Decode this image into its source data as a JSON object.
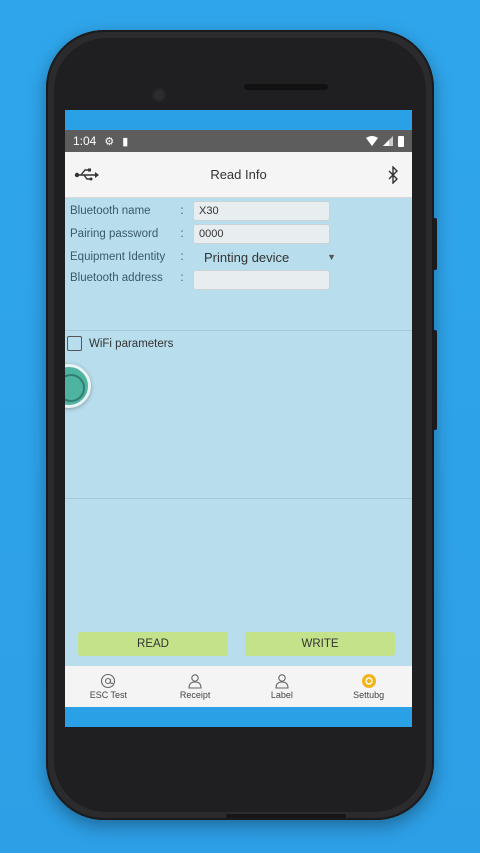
{
  "status": {
    "time": "1:04"
  },
  "appbar": {
    "title": "Read Info"
  },
  "form": {
    "bluetooth_name_label": "Bluetooth name",
    "bluetooth_name_value": "X30",
    "pairing_password_label": "Pairing password",
    "pairing_password_value": "0000",
    "equipment_identity_label": "Equipment Identity",
    "equipment_identity_value": "Printing device",
    "bluetooth_address_label": "Bluetooth address",
    "bluetooth_address_value": "",
    "colon": ":"
  },
  "wifi": {
    "label": "WiFi parameters",
    "checked": false
  },
  "buttons": {
    "read": "READ",
    "write": "WRITE"
  },
  "tabs": [
    {
      "label": "ESC Test",
      "icon": "at-icon"
    },
    {
      "label": "Receipt",
      "icon": "receipt-icon"
    },
    {
      "label": "Label",
      "icon": "label-icon"
    },
    {
      "label": "Settubg",
      "icon": "settings-icon",
      "active_color": "#f3b31b"
    }
  ]
}
